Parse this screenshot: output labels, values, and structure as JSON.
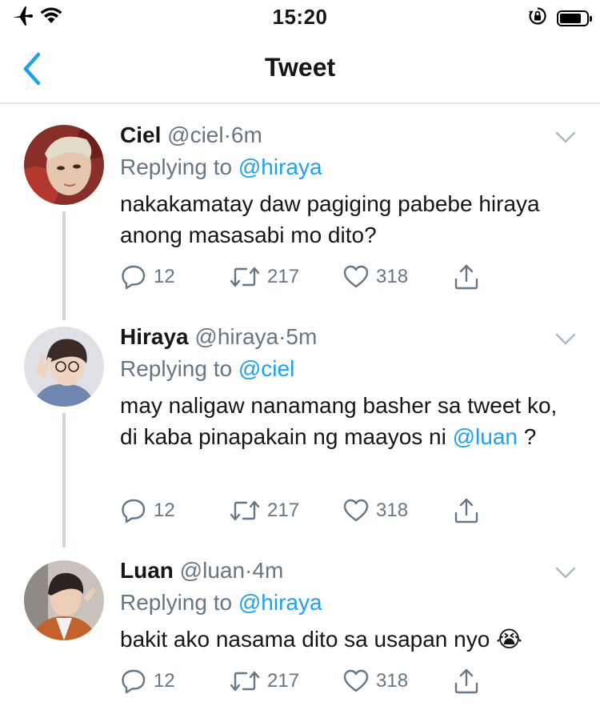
{
  "status_bar": {
    "time": "15:20"
  },
  "nav": {
    "title": "Tweet"
  },
  "tweets": [
    {
      "name": "Ciel",
      "handle": "@ciel",
      "time": "6m",
      "reply_prefix": "Replying to",
      "reply_to": "@hiraya",
      "text": "nakakamatay daw pagiging pabebe hiraya anong masasabi mo dito?",
      "replies": "12",
      "retweets": "217",
      "likes": "318"
    },
    {
      "name": "Hiraya",
      "handle": "@hiraya",
      "time": "5m",
      "reply_prefix": "Replying to",
      "reply_to": "@ciel",
      "text": "may naligaw nanamang basher sa tweet ko, di kaba pinapakain ng maayos ni",
      "text_mention": "@luan",
      "text_suffix": " ?",
      "replies": "12",
      "retweets": "217",
      "likes": "318"
    },
    {
      "name": "Luan",
      "handle": "@luan",
      "time": "4m",
      "reply_prefix": "Replying to",
      "reply_to": "@hiraya",
      "text": "bakit ako nasama dito sa usapan nyo",
      "emoji": "😭",
      "replies": "12",
      "retweets": "217",
      "likes": "318"
    }
  ],
  "colors": {
    "link": "#1da1f2",
    "muted": "#657786",
    "divider": "#e1e8ed"
  },
  "icons": [
    "airplane-icon",
    "wifi-icon",
    "orientation-lock-icon",
    "battery-icon",
    "back-chevron-icon",
    "caret-down-icon",
    "reply-icon",
    "retweet-icon",
    "like-icon",
    "share-icon"
  ]
}
